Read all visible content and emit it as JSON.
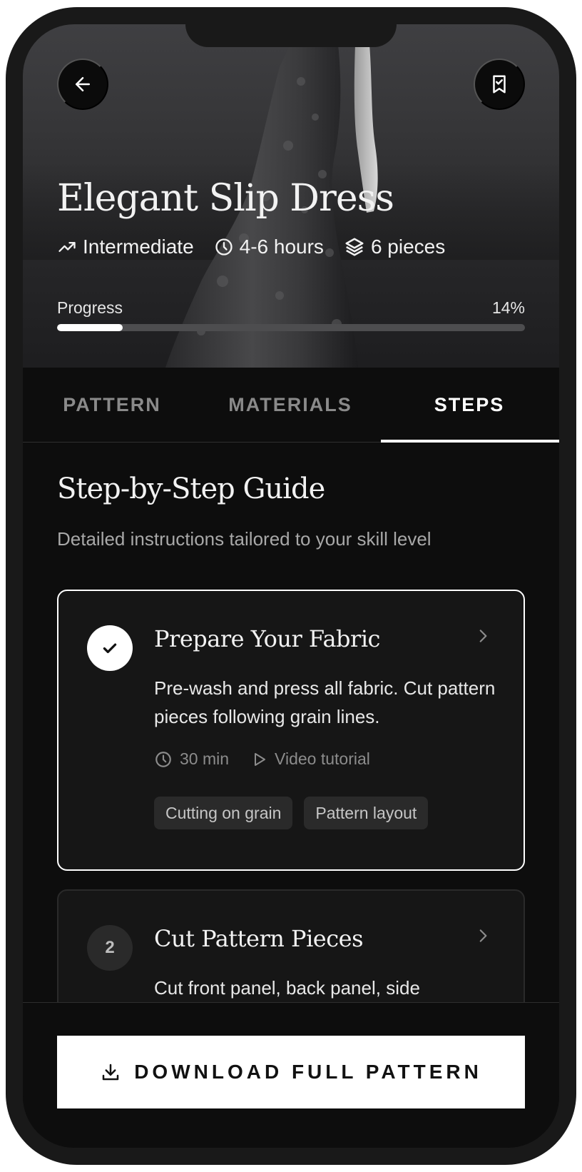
{
  "hero": {
    "title": "Elegant Slip Dress",
    "meta": {
      "level": "Intermediate",
      "duration": "4-6 hours",
      "pieces": "6 pieces"
    },
    "progress_label": "Progress",
    "progress_text": "14%",
    "progress_fraction": 0.14,
    "back_icon": "arrow-left-icon",
    "bookmark_icon": "bookmark-icon"
  },
  "tabs": [
    {
      "label": "PATTERN"
    },
    {
      "label": "MATERIALS"
    },
    {
      "label": "STEPS"
    }
  ],
  "active_tab": "STEPS",
  "guide": {
    "title": "Step-by-Step Guide",
    "subtitle": "Detailed instructions tailored to your skill level"
  },
  "steps": [
    {
      "status": "completed",
      "title": "Prepare Your Fabric",
      "description": "Pre-wash and press all fabric. Cut pattern pieces following grain lines.",
      "time": "30 min",
      "video": "Video tutorial",
      "tags": [
        "Cutting on grain",
        "Pattern layout"
      ]
    },
    {
      "number": "2",
      "title": "Cut Pattern Pieces",
      "description": "Cut front panel, back panel, side"
    }
  ],
  "download_label": "DOWNLOAD FULL PATTERN",
  "colors": {
    "background": "#0d0d0d",
    "card": "#161616",
    "accent": "#ffffff",
    "muted_text": "#8c8c8c"
  }
}
